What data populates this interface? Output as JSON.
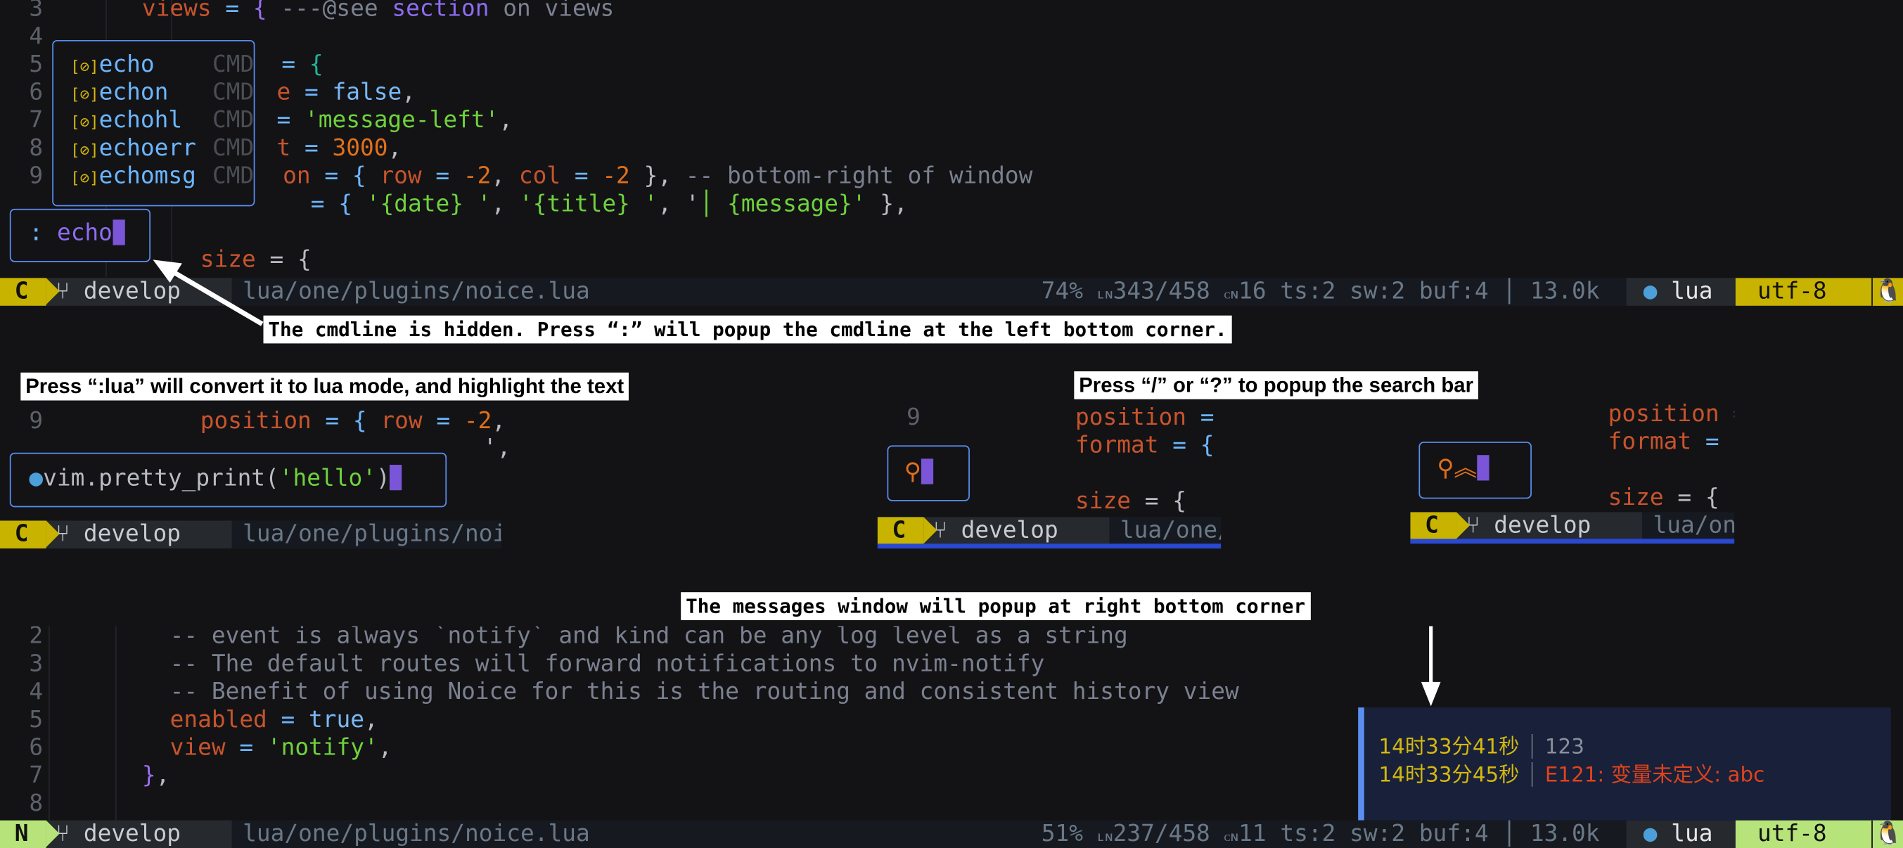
{
  "annotations": {
    "cmdline_hidden": "The cmdline is hidden. Press “:” will popup the cmdline at the left bottom corner.",
    "lua_mode": "Press “:lua” will convert it to lua mode, and highlight the text",
    "search_bar": "Press “/” or “?” to popup the search bar",
    "messages": "The messages window will popup at right bottom corner"
  },
  "panel1": {
    "line_numbers": [
      "3",
      "4",
      "5",
      "6",
      "7",
      "8",
      "9"
    ],
    "code": {
      "l3": [
        "views",
        " = ",
        "{",
        " ---@see ",
        "section",
        " on views"
      ],
      "l5": [
        "= ",
        "{"
      ],
      "l6": [
        "e",
        " = ",
        "false",
        ","
      ],
      "l7": [
        "= ",
        "'message-left'",
        ","
      ],
      "l8": [
        "t",
        " = ",
        "3000",
        ","
      ],
      "l9": [
        "on",
        " = { ",
        "row",
        " = ",
        "-2",
        ", ",
        "col",
        " = ",
        "-2",
        " }, ",
        "-- bottom-right of window"
      ],
      "l10": [
        "= { ",
        "'{date} '",
        ", ",
        "'{title} '",
        ", '",
        "│ {message}'",
        " },"
      ],
      "l12": [
        "size",
        " = {"
      ]
    },
    "completion": [
      {
        "label": "echo",
        "kind": "CMD"
      },
      {
        "label": "echon",
        "kind": "CMD"
      },
      {
        "label": "echohl",
        "kind": "CMD"
      },
      {
        "label": "echoerr",
        "kind": "CMD"
      },
      {
        "label": "echomsg",
        "kind": "CMD"
      }
    ],
    "cmdline": {
      "prompt": ":",
      "value": "echo"
    },
    "statusline": {
      "mode": "C",
      "branch": "develop",
      "path": "lua/one/plugins/noice.lua",
      "percent": "74%",
      "line": "343/458",
      "col": "16",
      "ts": "ts:2",
      "sw": "sw:2",
      "buf": "buf:4",
      "size": "13.0k",
      "filetype": "lua",
      "encoding": "utf-8"
    }
  },
  "panel2": {
    "line_number": "9",
    "code": [
      "position",
      " = { ",
      "row",
      " = ",
      "-2",
      ","
    ],
    "code2": "',",
    "cmdline": {
      "value_pre": "vim.pretty_print(",
      "value_str": "'hello'",
      "value_post": ")"
    },
    "statusline": {
      "mode": "C",
      "branch": "develop",
      "path": "lua/one/plugins/noi"
    }
  },
  "panel3": {
    "line_number": "9",
    "lines": [
      [
        "position",
        " ="
      ],
      [
        "format",
        " = {"
      ],
      [
        "size",
        " = {"
      ]
    ],
    "statusline": {
      "mode": "C",
      "branch": "develop",
      "path": "lua/one/"
    }
  },
  "panel4": {
    "lines": [
      [
        "position",
        " ="
      ],
      [
        "format",
        " ="
      ],
      [
        "size",
        " = {"
      ]
    ],
    "statusline": {
      "mode": "C",
      "branch": "develop",
      "path": "lua/on"
    }
  },
  "panel5": {
    "line_numbers": [
      "2",
      "3",
      "4",
      "5",
      "6",
      "7",
      "8"
    ],
    "lines": {
      "l2": "-- event is always `notify` and kind can be any log level as a string",
      "l3": "-- The default routes will forward notifications to nvim-notify",
      "l4": "-- Benefit of using Noice for this is the routing and consistent history view",
      "l5": [
        "enabled",
        " = ",
        "true",
        ","
      ],
      "l6": [
        "view",
        " = ",
        "'notify'",
        ","
      ],
      "l7": [
        "}",
        ","
      ]
    },
    "messages": [
      {
        "time": "14时33分41秒",
        "text": "123",
        "level": "info"
      },
      {
        "time": "14时33分45秒",
        "text": "E121: 变量未定义: abc",
        "level": "error"
      }
    ],
    "statusline": {
      "mode": "N",
      "branch": "develop",
      "path": "lua/one/plugins/noice.lua",
      "percent": "51%",
      "line": "237/458",
      "col": "11",
      "ts": "ts:2",
      "sw": "sw:2",
      "buf": "buf:4",
      "size": "13.0k",
      "filetype": "lua",
      "encoding": "utf-8"
    }
  },
  "colors": {
    "accent": "#5a8ff0",
    "mode_command": "#c8b400",
    "mode_normal": "#b7e47a",
    "cursor": "#7a55d8",
    "error": "#e0431c",
    "time": "#d4b80f"
  }
}
